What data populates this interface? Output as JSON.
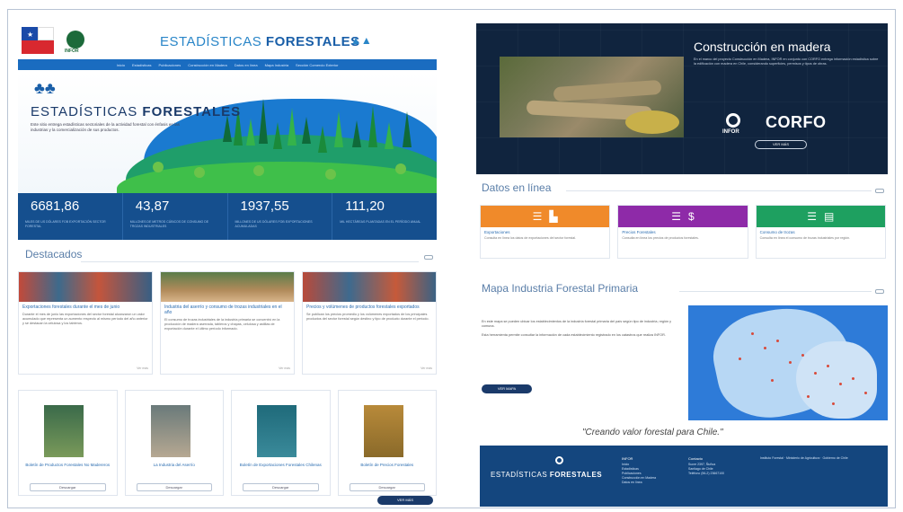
{
  "left": {
    "brand": {
      "prefix": "ESTADÍSTICAS ",
      "bold": "FORESTALES",
      "icon": "trees-icon"
    },
    "infor_logo_text": "INFOR",
    "nav_items": [
      "Inicio",
      "Estadísticas",
      "Publicaciones",
      "Construcción en Madera",
      "Datos en línea",
      "Mapa Industria",
      "Sección Comercio Exterior"
    ],
    "hero": {
      "title_prefix": "ESTADÍSTICAS ",
      "title_bold": "FORESTALES",
      "description": "Este sitio entrega estadísticas sectoriales de la actividad forestal con énfasis en las industrias y la comercialización de sus productos."
    },
    "stats": [
      {
        "value": "6681,86",
        "caption": "Miles de US dólares FOB exportación sector forestal"
      },
      {
        "value": "43,87",
        "caption": "Millones de metros cúbicos de consumo de trozas industriales"
      },
      {
        "value": "1937,55",
        "caption": "Millones de US dólares FOB exportaciones acumuladas"
      },
      {
        "value": "111,20",
        "caption": "Mil hectáreas plantadas en el período anual"
      }
    ],
    "destacados_title": "Destacados",
    "news": [
      {
        "title": "Exportaciones forestales durante el mes de junio",
        "body": "Durante el mes de junio las exportaciones del sector forestal alcanzaron un valor acumulado que representa un aumento respecto al mismo período del año anterior y se destacan la celulosa y los tableros.",
        "more": "Ver más"
      },
      {
        "title": "Industria del aserrío y consumo de trozas industriales en el año",
        "body": "El consumo de trozas industriales de la industria primaria se concentró en la producción de madera aserrada, tableros y chapas, celulosa y astillas de exportación durante el último período informado.",
        "more": "Ver más"
      },
      {
        "title": "Precios y volúmenes de productos forestales exportados",
        "body": "Se publican los precios promedio y los volúmenes exportados de los principales productos del sector forestal según destino y tipo de producto durante el período.",
        "more": "Ver más"
      }
    ],
    "publications": [
      {
        "title": "Boletín de Productos Forestales No Madereros",
        "button": "Descargar"
      },
      {
        "title": "La Industria del Aserrío",
        "button": "Descargar"
      },
      {
        "title": "Boletín de Exportaciones Forestales Chilenas",
        "button": "Descargar"
      },
      {
        "title": "Boletín de Precios Forestales",
        "button": "Descargar"
      }
    ],
    "see_more_button": "VER MÁS"
  },
  "right": {
    "banner": {
      "title": "Construcción en madera",
      "text": "En el marco del proyecto Construcción en Madera, INFOR en conjunto con CORFO entrega información estadística sobre la edificación con madera en Chile, considerando superficies, permisos y tipos de obras.",
      "infor": "INFOR",
      "corfo": "CORFO",
      "button": "VER MÁS"
    },
    "datos_title": "Datos en línea",
    "data_cards": [
      {
        "title": "Exportaciones",
        "body": "Consulta en línea los datos de exportaciones del sector forestal.",
        "color": "#f08a2a",
        "icons": [
          "database-icon",
          "factory-icon"
        ]
      },
      {
        "title": "Precios Forestales",
        "body": "Consulta en línea los precios de productos forestales.",
        "color": "#8e2aa8",
        "icons": [
          "database-icon",
          "dollar-icon"
        ]
      },
      {
        "title": "Consumo de trozas",
        "body": "Consulta en línea el consumo de trozas industriales por región.",
        "color": "#1ea060",
        "icons": [
          "database-icon",
          "logs-icon"
        ]
      }
    ],
    "mapa_title": "Mapa Industria Forestal Primaria",
    "mapa_text_1": "En este mapa se pueden ubicar los establecimientos de la industria forestal primaria del país según tipo de industria, región y comuna.",
    "mapa_text_2": "Esta herramienta permite consultar la información de cada establecimiento registrado en los catastros que realiza INFOR.",
    "mapa_button": "VER MAPA",
    "slogan": "\"Creando valor forestal para Chile.\"",
    "footer": {
      "brand_prefix": "ESTADÍSTICAS ",
      "brand_bold": "FORESTALES",
      "col1_head": "INFOR",
      "col1_items": [
        "Inicio",
        "Estadísticas",
        "Publicaciones",
        "Construcción en Madera",
        "Datos en línea"
      ],
      "col2_head": "Contacto",
      "col2_items": [
        "Sucre 2397, Ñuñoa",
        "Santiago de Chile",
        "Teléfono (56-2) 23667100"
      ],
      "col3_text": "Instituto Forestal · Ministerio de Agricultura · Gobierno de Chile"
    }
  }
}
